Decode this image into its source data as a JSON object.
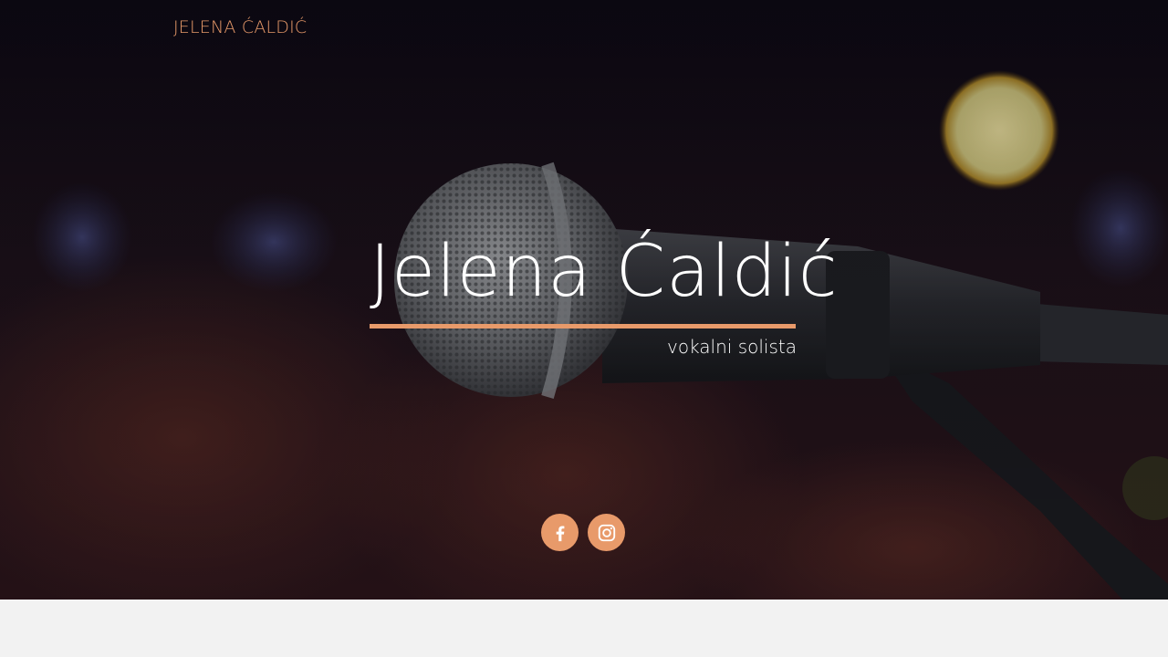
{
  "header": {
    "brand": "JELENA ĆALDIĆ"
  },
  "hero": {
    "title": "Jelena Ćaldić",
    "subtitle": "vokalni solista"
  },
  "social": [
    {
      "name": "facebook",
      "icon": "facebook-icon"
    },
    {
      "name": "instagram",
      "icon": "instagram-icon"
    }
  ],
  "colors": {
    "accent": "#e89a6a",
    "hero_text": "#ffffff",
    "footer_bg": "#f2f2f2"
  }
}
